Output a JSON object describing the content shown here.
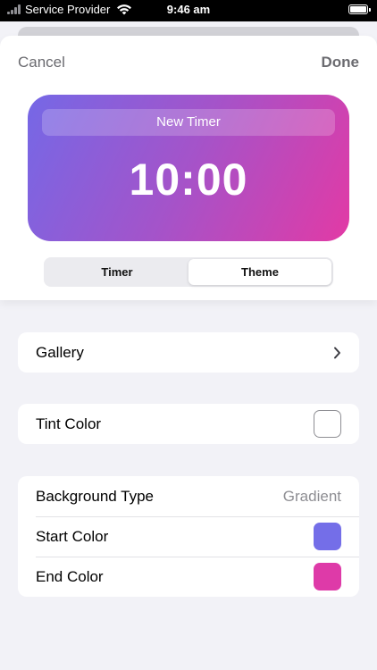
{
  "status_bar": {
    "carrier": "Service Provider",
    "time": "9:46 am"
  },
  "nav": {
    "cancel": "Cancel",
    "done": "Done"
  },
  "preview": {
    "name": "New Timer",
    "time": "10:00",
    "gradient_start": "#7568e6",
    "gradient_end": "#e23aa5"
  },
  "segments": [
    {
      "label": "Timer",
      "selected": false
    },
    {
      "label": "Theme",
      "selected": true
    }
  ],
  "settings": {
    "gallery": {
      "label": "Gallery",
      "icon": "chevron-right-icon"
    },
    "tint": {
      "label": "Tint Color",
      "color": "#ffffff"
    },
    "background_type": {
      "label": "Background Type",
      "value": "Gradient"
    },
    "start_color": {
      "label": "Start Color",
      "color": "#746ee8"
    },
    "end_color": {
      "label": "End Color",
      "color": "#de3aa8"
    }
  }
}
